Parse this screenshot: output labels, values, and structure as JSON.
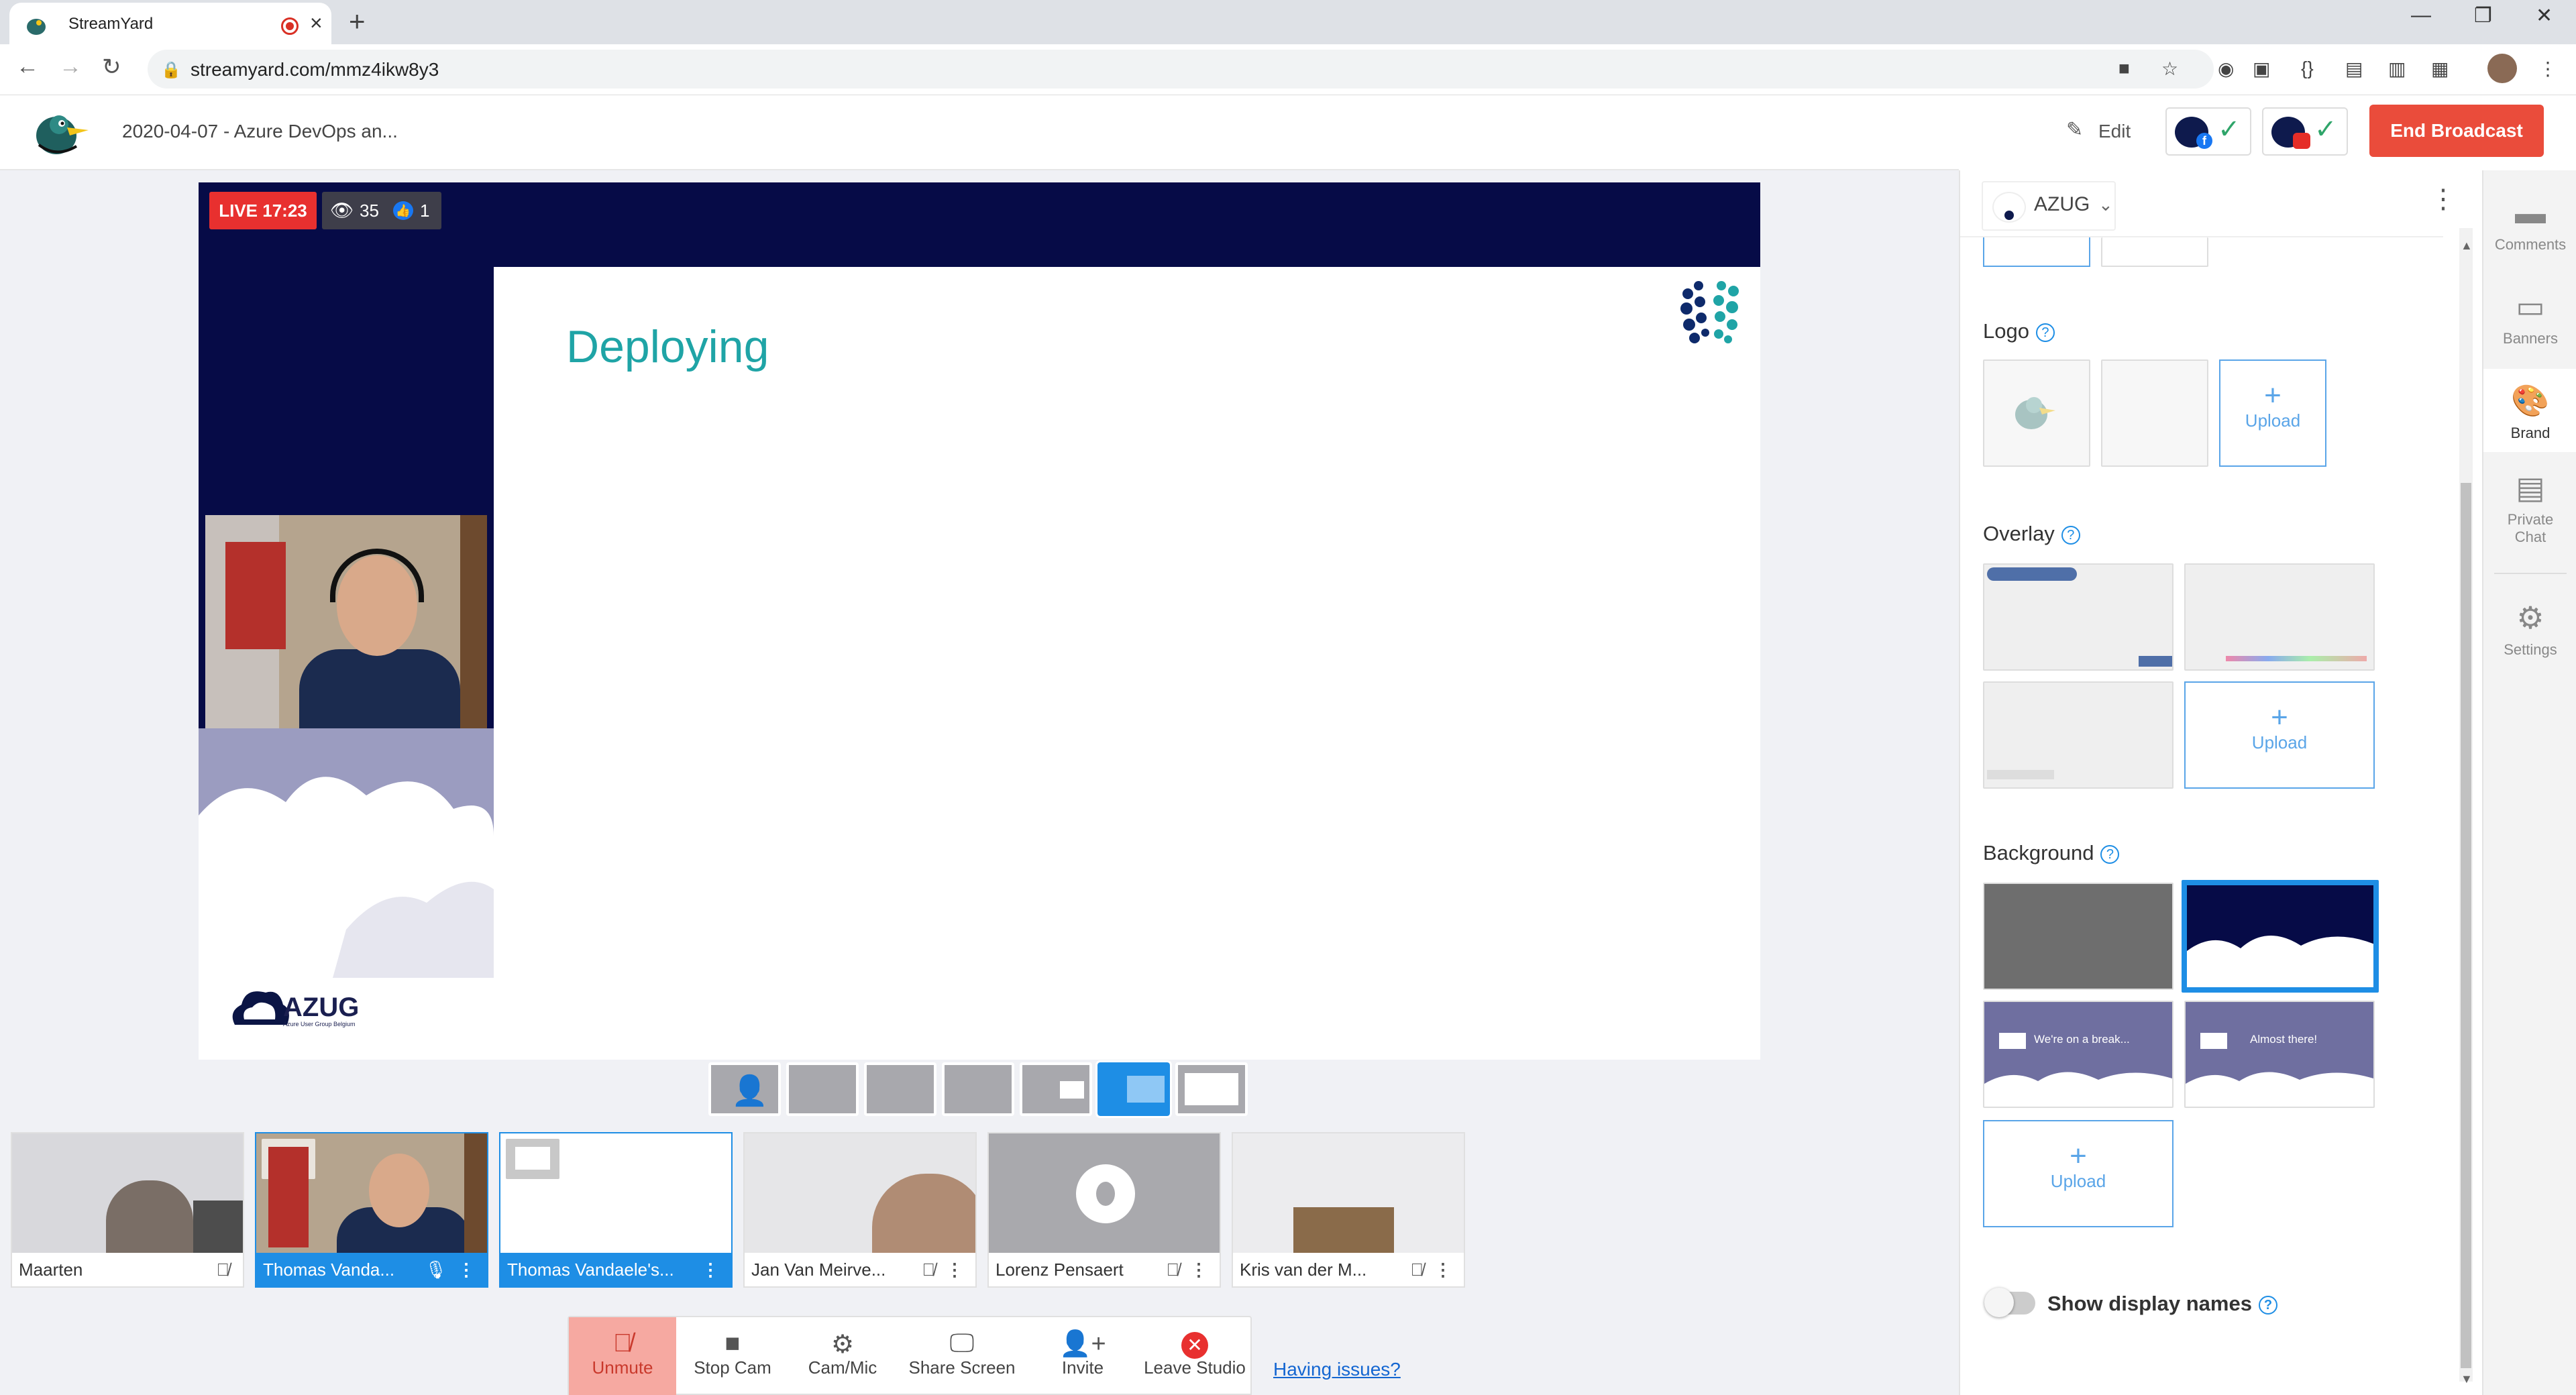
{
  "browser": {
    "tab_title": "StreamYard",
    "url": "streamyard.com/mmz4ikw8y3",
    "new_tab": "+",
    "close": "×"
  },
  "header": {
    "broadcast_title": "2020-04-07 - Azure DevOps an...",
    "edit_label": "Edit",
    "end_broadcast_label": "End Broadcast"
  },
  "stage": {
    "live_label": "LIVE 17:23",
    "viewers": "35",
    "likes": "1",
    "slide_title": "Deploying",
    "org_logo_text": "AZUG",
    "org_logo_sub": "Azure User Group Belgium"
  },
  "participants": [
    {
      "name": "Maarten",
      "selected": false
    },
    {
      "name": "Thomas Vanda...",
      "selected": true
    },
    {
      "name": "Thomas Vandaele's...",
      "selected": true
    },
    {
      "name": "Jan Van Meirve...",
      "selected": false
    },
    {
      "name": "Lorenz Pensaert",
      "selected": false
    },
    {
      "name": "Kris van der M...",
      "selected": false
    }
  ],
  "toolbar": {
    "unmute": "Unmute",
    "stop_cam": "Stop Cam",
    "cam_mic": "Cam/Mic",
    "share_screen": "Share Screen",
    "invite": "Invite",
    "leave_studio": "Leave Studio",
    "having_issues": "Having issues?"
  },
  "brand_panel": {
    "brand_name": "AZUG",
    "logo_title": "Logo",
    "overlay_title": "Overlay",
    "background_title": "Background",
    "upload_label": "Upload",
    "bg_thumb_1_text": "We're on a break...",
    "bg_thumb_2_text": "Almost there!",
    "show_display_names": "Show display names"
  },
  "rail": {
    "comments": "Comments",
    "banners": "Banners",
    "brand": "Brand",
    "private_chat_1": "Private",
    "private_chat_2": "Chat",
    "settings": "Settings"
  },
  "colors": {
    "accent": "#1e8ee5",
    "end_broadcast": "#ea4c3b",
    "live": "#e8302f",
    "stage_bg": "#060b47",
    "slide_title": "#1fa4a6"
  }
}
